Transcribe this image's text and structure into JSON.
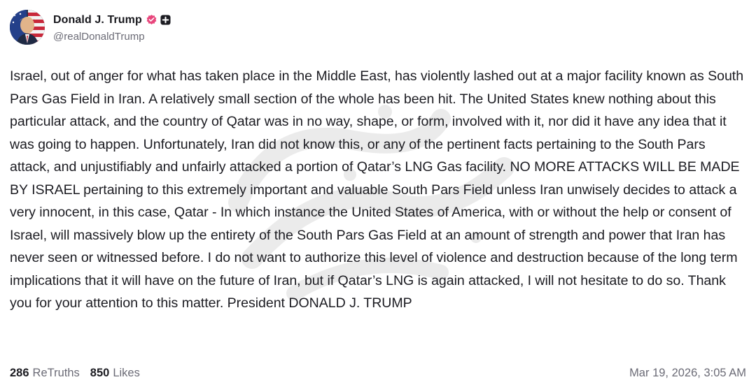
{
  "author": {
    "display_name": "Donald J. Trump",
    "handle": "@realDonaldTrump",
    "verified_badge_icon": "verified-badge-icon",
    "verified_color": "#e8467c",
    "plus_badge_icon": "plus-square-icon"
  },
  "post": {
    "text": "Israel, out of anger for what has taken place in the Middle East, has violently lashed out at a major facility known as South Pars Gas Field in Iran. A relatively small section of the whole has been hit. The United States knew nothing about this particular attack, and the country of Qatar was in no way, shape, or form, involved with it, nor did it have any idea that it was going to happen. Unfortunately, Iran did not know this, or any of the pertinent facts pertaining to the South Pars attack, and unjustifiably and unfairly attacked a portion of Qatar’s LNG Gas facility. NO MORE ATTACKS WILL BE MADE BY ISRAEL pertaining to this extremely important and valuable South Pars Field unless Iran unwisely decides to attack a very innocent, in this case, Qatar - In which instance the United States of America, with or without the help or consent of Israel, will massively blow up the entirety of the South Pars Gas Field at an amount of strength and power that Iran has never seen or witnessed before. I do not want to authorize this level of violence and destruction because of the long term implications that it will have on the future of Iran, but if Qatar’s LNG is again attacked, I will not hesitate to do so. Thank you for your attention to this matter. President DONALD J. TRUMP"
  },
  "stats": {
    "retruths_count": "286",
    "retruths_label": "ReTruths",
    "likes_count": "850",
    "likes_label": "Likes",
    "timestamp": "Mar 19, 2026, 3:05 AM"
  }
}
